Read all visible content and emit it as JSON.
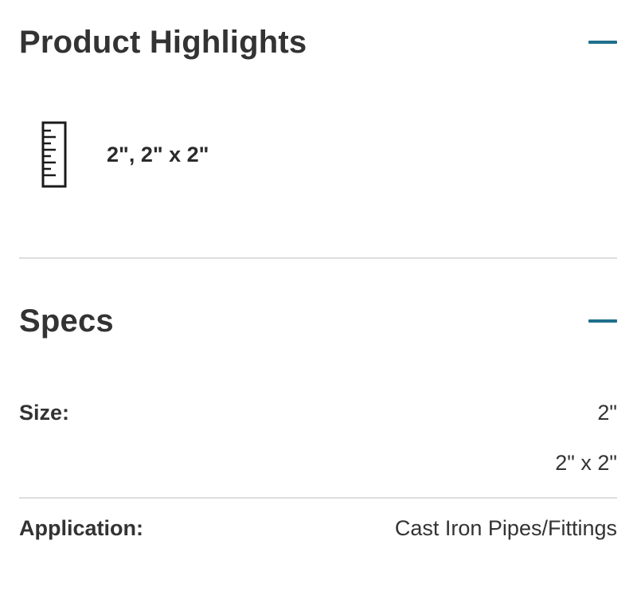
{
  "product_highlights": {
    "title": "Product Highlights",
    "toggle_icon": "minus-icon",
    "accent_color": "#1f6f8b",
    "items": [
      {
        "icon": "ruler-icon",
        "text": "2\", 2\" x 2\""
      }
    ]
  },
  "specs": {
    "title": "Specs",
    "toggle_icon": "minus-icon",
    "rows": [
      {
        "label": "Size:",
        "values": [
          "2\"",
          "2\" x 2\""
        ]
      },
      {
        "label": "Application:",
        "values": [
          "Cast Iron Pipes/Fittings"
        ]
      }
    ]
  }
}
